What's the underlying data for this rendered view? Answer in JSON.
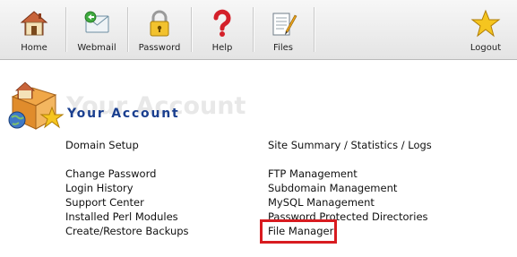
{
  "toolbar": {
    "home": "Home",
    "webmail": "Webmail",
    "password": "Password",
    "help": "Help",
    "files": "Files",
    "logout": "Logout"
  },
  "header": {
    "title": "Your Account",
    "ghost_title": "Your Account"
  },
  "left_links": {
    "domain_setup": "Domain Setup",
    "change_password": "Change Password",
    "login_history": "Login History",
    "support_center": "Support Center",
    "installed_perl_modules": "Installed Perl Modules",
    "create_restore_backups": "Create/Restore Backups"
  },
  "right_links": {
    "site_summary": "Site Summary / Statistics / Logs",
    "ftp_management": "FTP Management",
    "subdomain_management": "Subdomain Management",
    "mysql_management": "MySQL Management",
    "password_protected_directories": "Password Protected Directories",
    "file_manager": "File Manager"
  },
  "colors": {
    "title": "#1a3f8f",
    "highlight": "#d81b20"
  }
}
